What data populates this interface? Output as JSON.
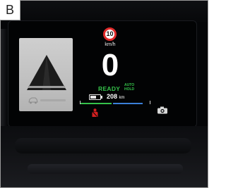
{
  "figure_label": "B",
  "limit_sign": {
    "value": "10"
  },
  "speed": {
    "unit": "km/h",
    "value": "0"
  },
  "status": {
    "ready": "READY",
    "auto_hold_line1": "AUTO",
    "auto_hold_line2": "HOLD"
  },
  "range": {
    "value": "208",
    "unit": "km",
    "battery_fraction": 0.6
  },
  "range_bar": {
    "green_fraction": 0.45,
    "blue_fraction": 0.42
  },
  "colors": {
    "ready_green": "#35c24a",
    "limit_red": "#e02a2a",
    "range_blue": "#3a7fd8",
    "warning_red": "#d42020"
  },
  "icons": {
    "limit": "speed-limit-sign-icon",
    "battery": "battery-icon",
    "seatbelt": "seatbelt-warning-icon",
    "camera": "camera-icon",
    "lane": "lane-road-icon",
    "car": "car-icon"
  }
}
